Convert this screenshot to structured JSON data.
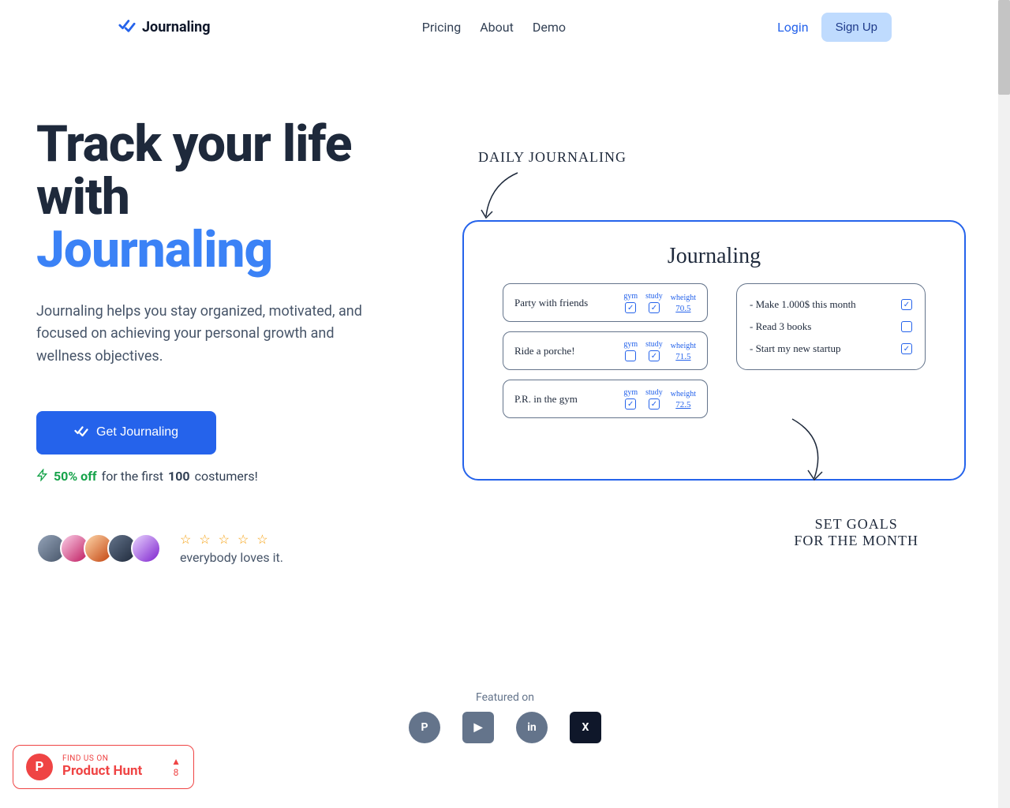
{
  "header": {
    "brand": "Journaling",
    "nav": {
      "pricing": "Pricing",
      "about": "About",
      "demo": "Demo"
    },
    "login": "Login",
    "signup": "Sign Up"
  },
  "hero": {
    "title_line1": "Track your life",
    "title_line2": "with",
    "title_brand": "Journaling",
    "subtitle": "Journaling helps you stay organized, motivated, and focused on achieving your personal growth and wellness objectives.",
    "cta": "Get Journaling",
    "discount_pct": "50% off",
    "discount_mid": " for the first ",
    "discount_num": "100",
    "discount_end": " costumers!",
    "loves": "everybody loves it."
  },
  "illustration": {
    "label_top": "DAILY JOURNALING",
    "label_bottom_l1": "SET GOALS",
    "label_bottom_l2": "FOR THE MONTH",
    "title": "Journaling",
    "metric_labels": {
      "gym": "gym",
      "study": "study",
      "weight": "wheight"
    },
    "entries": [
      {
        "text": "Party with friends",
        "gym": true,
        "study": true,
        "weight": "70.5"
      },
      {
        "text": "Ride a porche!",
        "gym": false,
        "study": true,
        "weight": "71.5"
      },
      {
        "text": "P.R. in the gym",
        "gym": true,
        "study": true,
        "weight": "72.5"
      }
    ],
    "goals": [
      {
        "text": "- Make 1.000$ this month",
        "done": true
      },
      {
        "text": "- Read 3 books",
        "done": false
      },
      {
        "text": "- Start my new startup",
        "done": true
      }
    ]
  },
  "featured": {
    "label": "Featured on"
  },
  "ph": {
    "small": "FIND US ON",
    "big": "Product Hunt",
    "votes": "8"
  }
}
